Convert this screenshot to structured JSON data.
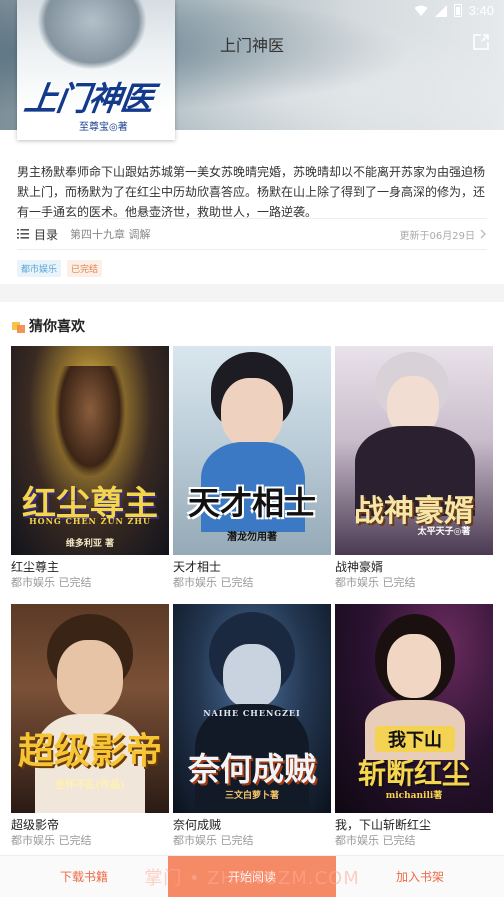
{
  "status_bar": {
    "time": "3:40"
  },
  "header": {
    "title": "上门神医"
  },
  "book": {
    "cover_title": "上门神医",
    "cover_author": "至尊宝◎著",
    "description": "男主杨默奉师命下山跟姑苏城第一美女苏晚晴完婚，苏晚晴却以不能离开苏家为由强迫杨默上门，而杨默为了在红尘中历劫欣喜答应。杨默在山上除了得到了一身高深的修为，还有一手通玄的医术。他悬壶济世，救助世人，一路逆袭。",
    "toc_label": "目录",
    "latest_chapter": "第四十九章 调解",
    "update_date": "更新于06月29日",
    "tags": [
      "都市娱乐",
      "已完结"
    ]
  },
  "recommend": {
    "title": "猜你喜欢",
    "books": [
      {
        "name": "红尘尊主",
        "meta": "都市娱乐 已完结",
        "cover_text": "红尘尊主",
        "cover_sub": "HONG CHEN ZUN ZHU",
        "cover_author": "维多利亚 著"
      },
      {
        "name": "天才相士",
        "meta": "都市娱乐 已完结",
        "cover_text": "天才相士",
        "cover_author": "潜龙勿用著"
      },
      {
        "name": "战神豪婿",
        "meta": "都市娱乐 已完结",
        "cover_text": "战神豪婿",
        "cover_author": "太平天子◎著"
      },
      {
        "name": "超级影帝",
        "meta": "都市娱乐 已完结",
        "cover_text": "超级影帝",
        "cover_author": "坐怀不乱(作品)"
      },
      {
        "name": "奈何成贼",
        "meta": "都市娱乐 已完结",
        "cover_text": "奈何成贼",
        "cover_sub": "NAIHE CHENGZEI",
        "cover_author": "三文白萝卜著"
      },
      {
        "name": "我，下山斩断红尘",
        "meta": "都市娱乐 已完结",
        "cover_text": "斩断红尘",
        "cover_top": "我下山",
        "cover_author": "michanili著"
      }
    ]
  },
  "bottom_bar": {
    "download": "下载书籍",
    "read": "开始阅读",
    "shelf": "加入书架"
  },
  "watermark": "掌门 • ZHANGZM.COM",
  "colors": {
    "accent": "#ef6a45",
    "primary_button": "#f58a66"
  }
}
